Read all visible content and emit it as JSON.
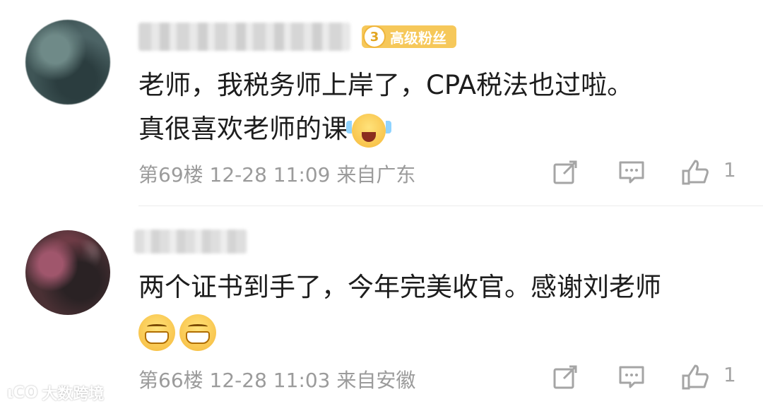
{
  "comments": [
    {
      "fan_badge": {
        "level": "3",
        "label": "高级粉丝"
      },
      "text_line1": "老师，我税务师上岸了，CPA税法也过啦。",
      "text_line2": "真很喜欢老师的课",
      "floor": "第69楼",
      "time": "12-28 11:09",
      "location": "来自广东",
      "likes": "1"
    },
    {
      "text_line1": "两个证书到手了，今年完美收官。感谢刘老师",
      "floor": "第66楼",
      "time": "12-28 11:03",
      "location": "来自安徽",
      "likes": "1"
    }
  ],
  "watermark": {
    "logo": "ιCO",
    "text": "大数跨境"
  },
  "colors": {
    "badge": "#f6c85a",
    "meta": "#9b9b9b",
    "text": "#1d1d1d"
  },
  "icons": [
    "share-icon",
    "comment-icon",
    "like-icon"
  ]
}
